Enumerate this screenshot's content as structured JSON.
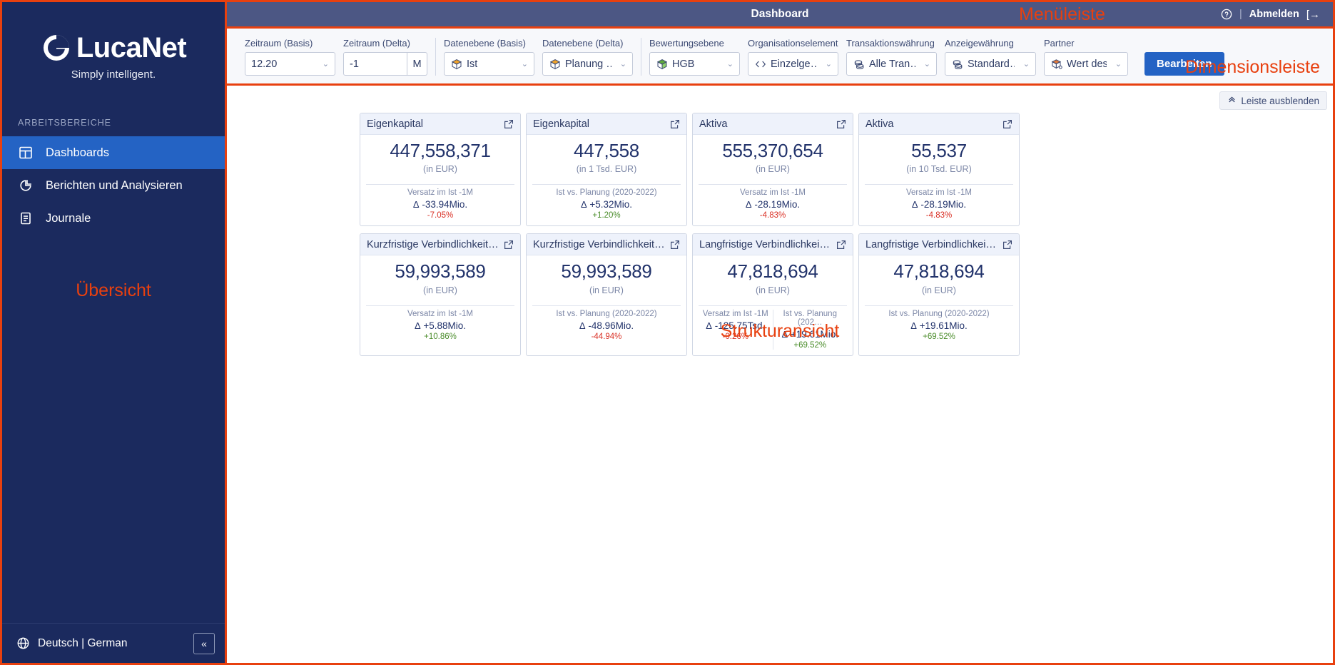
{
  "sidebar": {
    "logo_text": "LucaNet",
    "logo_tagline": "Simply intelligent.",
    "section_label": "ARBEITSBEREICHE",
    "items": [
      {
        "label": "Dashboards",
        "icon": "dashboard-icon",
        "active": true
      },
      {
        "label": "Berichten und Analysieren",
        "icon": "pie-chart-icon",
        "active": false
      },
      {
        "label": "Journale",
        "icon": "journal-icon",
        "active": false
      }
    ],
    "overview_annotation": "Übersicht",
    "language": "Deutsch | German",
    "collapse_label": "«"
  },
  "menubar": {
    "title": "Dashboard",
    "annotation": "Menüleiste",
    "help_icon": "help-circle-icon",
    "separator": "|",
    "logout_label": "Abmelden",
    "logout_icon": "[→"
  },
  "dimbar": {
    "annotation": "Dimensionsleiste",
    "edit_label": "Bearbeiten",
    "groups": [
      {
        "fields": [
          {
            "label": "Zeitraum (Basis)",
            "value": "12.20",
            "icon": null,
            "width": "w-zb",
            "unit": null
          },
          {
            "label": "Zeitraum (Delta)",
            "value": "-1",
            "icon": null,
            "width": "w-zd",
            "unit": "M"
          }
        ]
      },
      {
        "fields": [
          {
            "label": "Datenebene (Basis)",
            "value": "Ist",
            "icon": "cube-orange-icon",
            "width": "w-de",
            "unit": null
          },
          {
            "label": "Datenebene (Delta)",
            "value": "Planung …",
            "icon": "cube-orange-icon",
            "width": "w-de",
            "unit": null
          }
        ]
      },
      {
        "fields": [
          {
            "label": "Bewertungsebene",
            "value": "HGB",
            "icon": "cube-green-icon",
            "width": "w-de",
            "unit": null
          },
          {
            "label": "Organisationselement",
            "value": "Einzelge…",
            "icon": "diamond-icon",
            "width": "w-de",
            "unit": null
          },
          {
            "label": "Transaktionswährung",
            "value": "Alle Tran…",
            "icon": "coins-icon",
            "width": "w-de",
            "unit": null
          },
          {
            "label": "Anzeigewährung",
            "value": "Standard…",
            "icon": "coins-icon",
            "width": "w-std",
            "unit": null
          },
          {
            "label": "Partner",
            "value": "Wert des…",
            "icon": "cube-orange-icon",
            "width": "w-part",
            "unit": null
          }
        ]
      }
    ]
  },
  "content": {
    "hide_bar_label": "Leiste ausblenden",
    "hide_bar_icon": "chevron-up-double-icon",
    "structure_annotation": "Strukturansicht",
    "cards": [
      {
        "title": "Eigenkapital",
        "value": "447,558,371",
        "unit": "(in EUR)",
        "footers": [
          {
            "label": "Versatz im Ist -1M",
            "delta": "-33.94Mio.",
            "pct": "-7.05%",
            "pct_sign": "neg"
          }
        ]
      },
      {
        "title": "Eigenkapital",
        "value": "447,558",
        "unit": "(in 1 Tsd. EUR)",
        "footers": [
          {
            "label": "Ist vs. Planung (2020-2022)",
            "delta": "+5.32Mio.",
            "pct": "+1.20%",
            "pct_sign": "pos"
          }
        ]
      },
      {
        "title": "Aktiva",
        "value": "555,370,654",
        "unit": "(in EUR)",
        "footers": [
          {
            "label": "Versatz im Ist -1M",
            "delta": "-28.19Mio.",
            "pct": "-4.83%",
            "pct_sign": "neg"
          }
        ]
      },
      {
        "title": "Aktiva",
        "value": "55,537",
        "unit": "(in 10 Tsd. EUR)",
        "footers": [
          {
            "label": "Versatz im Ist -1M",
            "delta": "-28.19Mio.",
            "pct": "-4.83%",
            "pct_sign": "neg"
          }
        ]
      },
      {
        "title": "Kurzfristige Verbindlichkeiten",
        "value": "59,993,589",
        "unit": "(in EUR)",
        "footers": [
          {
            "label": "Versatz im Ist -1M",
            "delta": "+5.88Mio.",
            "pct": "+10.86%",
            "pct_sign": "pos"
          }
        ]
      },
      {
        "title": "Kurzfristige Verbindlichkeiten",
        "value": "59,993,589",
        "unit": "(in EUR)",
        "footers": [
          {
            "label": "Ist vs. Planung (2020-2022)",
            "delta": "-48.96Mio.",
            "pct": "-44.94%",
            "pct_sign": "neg"
          }
        ]
      },
      {
        "title": "Langfristige Verbindlichkeiten",
        "value": "47,818,694",
        "unit": "(in EUR)",
        "footers": [
          {
            "label": "Versatz im Ist -1M",
            "delta": "-125.75Tsd.",
            "pct": "-0.26%",
            "pct_sign": "neg"
          },
          {
            "label": "Ist vs. Planung (202…",
            "delta": "+19.61Mio.",
            "pct": "+69.52%",
            "pct_sign": "pos"
          }
        ]
      },
      {
        "title": "Langfristige Verbindlichkeiten",
        "value": "47,818,694",
        "unit": "(in EUR)",
        "footers": [
          {
            "label": "Ist vs. Planung (2020-2022)",
            "delta": "+19.61Mio.",
            "pct": "+69.52%",
            "pct_sign": "pos"
          }
        ]
      }
    ]
  },
  "colors": {
    "sidebar_bg": "#1b2a5e",
    "accent_blue": "#2463c4",
    "annotation_red": "#e8400f",
    "menubar_bg": "#4c5784",
    "positive": "#4a8c2a",
    "negative": "#d93025"
  }
}
